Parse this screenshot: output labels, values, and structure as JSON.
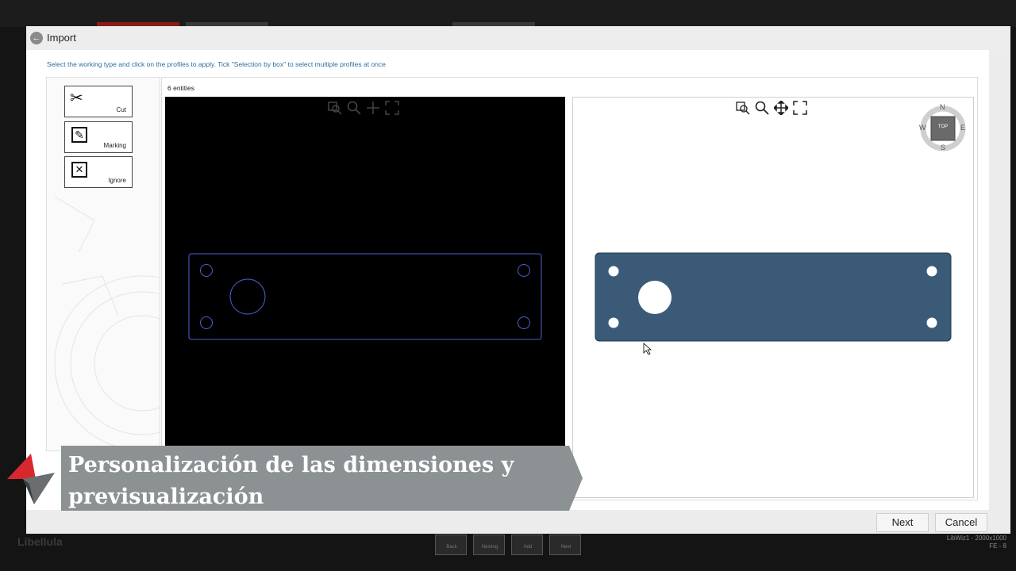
{
  "dialog": {
    "title": "Import",
    "instruction": "Select the working type and click on the profiles to apply. Tick \"Selection by box\" to select multiple profiles at once"
  },
  "tools": [
    {
      "label": "Cut",
      "icon": "scissors-icon",
      "glyph": "✂"
    },
    {
      "label": "Marking",
      "icon": "edit-icon",
      "glyph": "✎"
    },
    {
      "label": "Ignore",
      "icon": "ignore-icon",
      "glyph": "✕"
    }
  ],
  "cad_view": {
    "entity_count": "6 entities",
    "toolbar": [
      "zoom-window-icon",
      "zoom-icon",
      "pan-icon",
      "fit-icon"
    ]
  },
  "preview_view": {
    "toolbar": [
      "zoom-window-icon",
      "zoom-icon",
      "pan-icon",
      "fit-icon"
    ],
    "compass": {
      "top": "TOP",
      "n": "N",
      "s": "S",
      "e": "E",
      "w": "W"
    }
  },
  "subtitle": {
    "line1": "Personalización de las dimensiones y",
    "line2": "previsualización"
  },
  "footer": {
    "next": "Next",
    "cancel": "Cancel"
  },
  "taskbar": {
    "buttons": [
      "Back",
      "Nesting",
      "Add",
      "Next"
    ],
    "status_line1": "LibWiz1 - 2000x1000",
    "status_line2": "FE - 8",
    "brand": "Libellula"
  },
  "colors": {
    "part_fill": "#3a5a78",
    "cad_outline": "#4b5fd0",
    "subtitle_bg": "#8c9194",
    "logo_red": "#d8282f"
  }
}
